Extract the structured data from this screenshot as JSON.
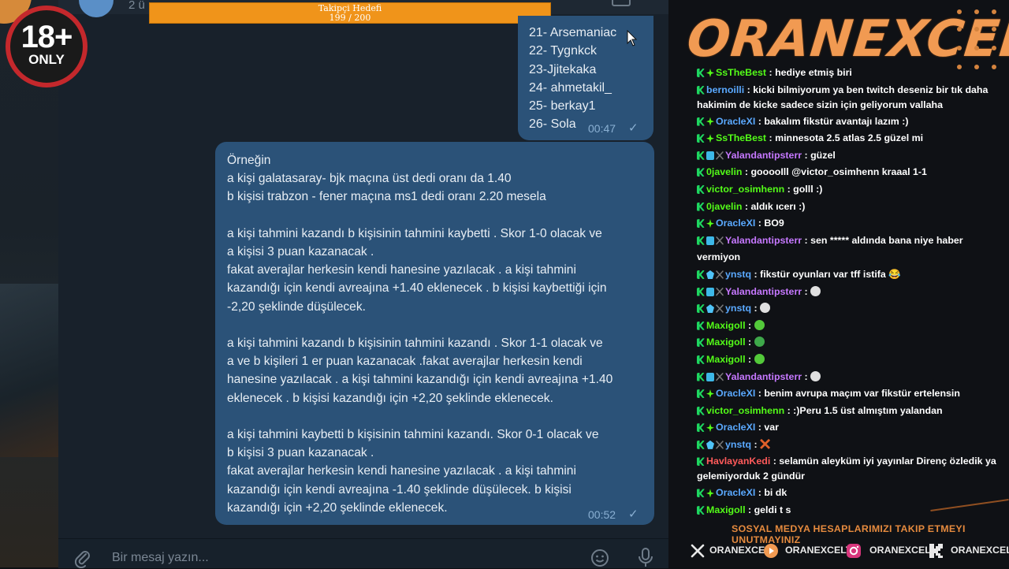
{
  "header": {
    "subtitle": "2 ü",
    "goal_title": "Takipçi Hedefi",
    "goal_progress": "199 / 200",
    "goal_fraction": 0.995
  },
  "badge": {
    "line1": "18+",
    "line2": "ONLY"
  },
  "messages": {
    "list_bubble": {
      "lines": [
        "21- Arsemaniac",
        "22- Tygnkck",
        "23-Jjitekaka",
        "24- ahmetakil_",
        "25- berkay1",
        "26- Sola"
      ],
      "time": "00:47"
    },
    "long_bubble": {
      "paragraphs": [
        [
          "Örneğin",
          "a kişi galatasaray- bjk maçına üst dedi oranı da 1.40",
          "b kişisi trabzon - fener maçına ms1 dedi oranı 2.20 mesela"
        ],
        [
          "a kişi tahmini kazandı b kişisinin tahmini kaybetti . Skor 1-0 olacak ve",
          "a kişisi 3 puan kazanacak .",
          "fakat averajlar herkesin kendi hanesine yazılacak . a kişi tahmini",
          "kazandığı için kendi avreajına +1.40 eklenecek . b kişisi kaybettiği için",
          "-2,20 şeklinde düşülecek."
        ],
        [
          "a kişi tahmini kazandı b kişisinin tahmini kazandı . Skor 1-1 olacak ve",
          "a ve b kişileri 1 er puan kazanacak .fakat averajlar herkesin kendi",
          "hanesine yazılacak . a kişi tahmini kazandığı için kendi avreajına +1.40",
          "eklenecek . b kişisi kazandığı için +2,20 şeklinde eklenecek."
        ],
        [
          "a kişi tahmini kaybetti b kişisinin tahmini kazandı. Skor 0-1 olacak ve",
          "b kişisi 3 puan kazanacak .",
          "fakat averajlar herkesin kendi hanesine yazılacak . a kişi tahmini",
          "kazandığı için kendi avreajına -1.40 şeklinde düşülecek. b kişisi",
          "kazandığı için +2,20 şeklinde eklenecek."
        ]
      ],
      "time": "00:52"
    }
  },
  "input": {
    "placeholder": "Bir mesaj yazın..."
  },
  "stream": {
    "brand": "ORANEXCEL",
    "chat": [
      {
        "badges": [
          "k",
          "star"
        ],
        "user": "SsTheBest",
        "color": "#53fc18",
        "text": "hediye etmiş biri"
      },
      {
        "badges": [
          "k"
        ],
        "user": "bernoilli",
        "color": "#5aa9ff",
        "text": "kicki bilmiyorum ya ben twitch deseniz bir tık daha hakimim de kicke sadece sizin için geliyorum vallaha"
      },
      {
        "badges": [
          "k",
          "star"
        ],
        "user": "OracleXI",
        "color": "#5aa9ff",
        "text": "bakalım fikstür avantajı lazım :)"
      },
      {
        "badges": [
          "k",
          "star"
        ],
        "user": "SsTheBest",
        "color": "#53fc18",
        "text": "minnesota 2.5 atlas 2.5 güzel mi"
      },
      {
        "badges": [
          "k",
          "sub",
          "x"
        ],
        "user": "Yalandantipsterr",
        "color": "#c678ff",
        "text": "güzel"
      },
      {
        "badges": [
          "k"
        ],
        "user": "0javelin",
        "color": "#53fc18",
        "text": "gooooIll @victor_osimhenn kraaal 1-1"
      },
      {
        "badges": [
          "k"
        ],
        "user": "victor_osimhenn",
        "color": "#53fc18",
        "text": "golll :)"
      },
      {
        "badges": [
          "k"
        ],
        "user": "0javelin",
        "color": "#53fc18",
        "text": "aldık ıcerı :)"
      },
      {
        "badges": [
          "k",
          "star"
        ],
        "user": "OracleXI",
        "color": "#5aa9ff",
        "text": "BO9"
      },
      {
        "badges": [
          "k",
          "sub",
          "x"
        ],
        "user": "Yalandantipsterr",
        "color": "#c678ff",
        "text": "sen ***** aldında bana niye haber vermiyon"
      },
      {
        "badges": [
          "k",
          "gem",
          "x"
        ],
        "user": "ynstq",
        "color": "#5aa9ff",
        "text": "fikstür oyunları var tff istifa 😂"
      },
      {
        "badges": [
          "k",
          "sub",
          "x"
        ],
        "user": "Yalandantipsterr",
        "color": "#c678ff",
        "text": ""
      },
      {
        "badges": [
          "k",
          "gem",
          "x"
        ],
        "user": "ynstq",
        "color": "#5aa9ff",
        "text": ""
      },
      {
        "badges": [
          "k"
        ],
        "user": "Maxigoll",
        "color": "#53fc18",
        "text": ""
      },
      {
        "badges": [
          "k"
        ],
        "user": "Maxigoll",
        "color": "#53fc18",
        "text": ""
      },
      {
        "badges": [
          "k"
        ],
        "user": "Maxigoll",
        "color": "#53fc18",
        "text": ""
      },
      {
        "badges": [
          "k",
          "sub",
          "x"
        ],
        "user": "Yalandantipsterr",
        "color": "#c678ff",
        "text": ""
      },
      {
        "badges": [
          "k",
          "star"
        ],
        "user": "OracleXI",
        "color": "#5aa9ff",
        "text": "benim avrupa maçım var fikstür ertelensin"
      },
      {
        "badges": [
          "k"
        ],
        "user": "victor_osimhenn",
        "color": "#53fc18",
        "text": ":)Peru 1.5 üst almıştım yalandan"
      },
      {
        "badges": [
          "k",
          "star"
        ],
        "user": "OracleXI",
        "color": "#5aa9ff",
        "text": "var"
      },
      {
        "badges": [
          "k",
          "gem",
          "x"
        ],
        "user": "ynstq",
        "color": "#5aa9ff",
        "text": ""
      },
      {
        "badges": [
          "k"
        ],
        "user": "HavlayanKedi",
        "color": "#ff5a5a",
        "text": "selamün aleyküm iyi yayınlar Direnç özledik ya gelemiyorduk 2 gündür"
      },
      {
        "badges": [
          "k",
          "star"
        ],
        "user": "OracleXI",
        "color": "#5aa9ff",
        "text": "bi dk"
      },
      {
        "badges": [
          "k"
        ],
        "user": "Maxigoll",
        "color": "#53fc18",
        "text": "geldi t s"
      }
    ],
    "emotes": [
      {
        "index": 11,
        "icon": "ghost-emote-icon",
        "color": "#e0e0e0"
      },
      {
        "index": 12,
        "icon": "ghost-emote-icon",
        "color": "#e0e0e0"
      },
      {
        "index": 13,
        "icon": "green-blob-emote-icon",
        "color": "#53c93a"
      },
      {
        "index": 14,
        "icon": "green-frog-emote-icon",
        "color": "#3ea84a"
      },
      {
        "index": 15,
        "icon": "green-blob-emote-icon",
        "color": "#53c93a"
      },
      {
        "index": 16,
        "icon": "ghost-emote-icon",
        "color": "#e0e0e0"
      },
      {
        "index": 20,
        "icon": "cross-emote-icon",
        "color": "#e0602a"
      }
    ],
    "follow_text": "SOSYAL MEDYA HESAPLARIMIZI TAKIP ETMEYI UNUTMAYINIZ",
    "socials": [
      {
        "icon": "x-logo-icon",
        "label": "ORANEXCEL"
      },
      {
        "icon": "youtube-play-icon",
        "label": "ORANEXCELTV"
      },
      {
        "icon": "instagram-icon",
        "label": "ORANEXCELL"
      },
      {
        "icon": "kick-logo-icon",
        "label": "ORANEXCELTV"
      }
    ]
  },
  "colors": {
    "bubble": "#2b5278",
    "chat_bg": "#18212b",
    "brand": "#f19a52",
    "goal": "#f0941a"
  }
}
